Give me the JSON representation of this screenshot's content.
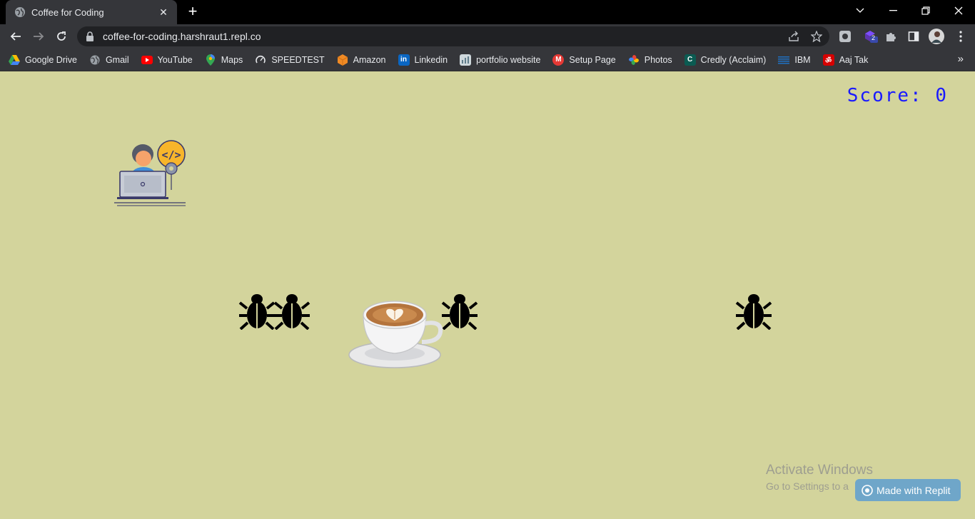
{
  "browser": {
    "tab": {
      "title": "Coffee for Coding",
      "close_icon": "close-icon"
    },
    "new_tab_label": "+",
    "url": "coffee-for-coding.harshraut1.repl.co",
    "extension_badge": "2",
    "bookmarks": [
      {
        "label": "Google Drive",
        "icon": "google-drive-icon",
        "color": "#34a853"
      },
      {
        "label": "Gmail",
        "icon": "globe-icon",
        "color": "#9aa0a6"
      },
      {
        "label": "YouTube",
        "icon": "youtube-icon",
        "color": "#ff0000"
      },
      {
        "label": "Maps",
        "icon": "maps-icon",
        "color": "#34a853"
      },
      {
        "label": "SPEEDTEST",
        "icon": "speedtest-icon",
        "color": "#ffffff"
      },
      {
        "label": "Amazon",
        "icon": "amazon-icon",
        "color": "#f08a24"
      },
      {
        "label": "Linkedin",
        "icon": "linkedin-icon",
        "color": "#0a66c2"
      },
      {
        "label": "portfolio website",
        "icon": "portfolio-icon",
        "color": "#cfd8dc"
      },
      {
        "label": "Setup Page",
        "icon": "setup-page-icon",
        "color": "#e53935"
      },
      {
        "label": "Photos",
        "icon": "photos-icon",
        "color": "#fbbc04"
      },
      {
        "label": "Credly (Acclaim)",
        "icon": "credly-icon",
        "color": "#0b8a7a"
      },
      {
        "label": "IBM",
        "icon": "ibm-icon",
        "color": "#1f70c1"
      },
      {
        "label": "Aaj Tak",
        "icon": "aaj-tak-icon",
        "color": "#d50000"
      }
    ]
  },
  "game": {
    "score_label": "Score:",
    "score_value": "0",
    "score_color": "#1a1aff",
    "background_color": "#d3d49c",
    "player": "coder-icon",
    "cup": "coffee-cup-icon",
    "bugs": [
      "bug-icon",
      "bug-icon",
      "bug-icon",
      "bug-icon"
    ]
  },
  "overlay": {
    "activate_title": "Activate Windows",
    "activate_sub": "Go to Settings to a",
    "replit_badge": "Made with Replit"
  }
}
